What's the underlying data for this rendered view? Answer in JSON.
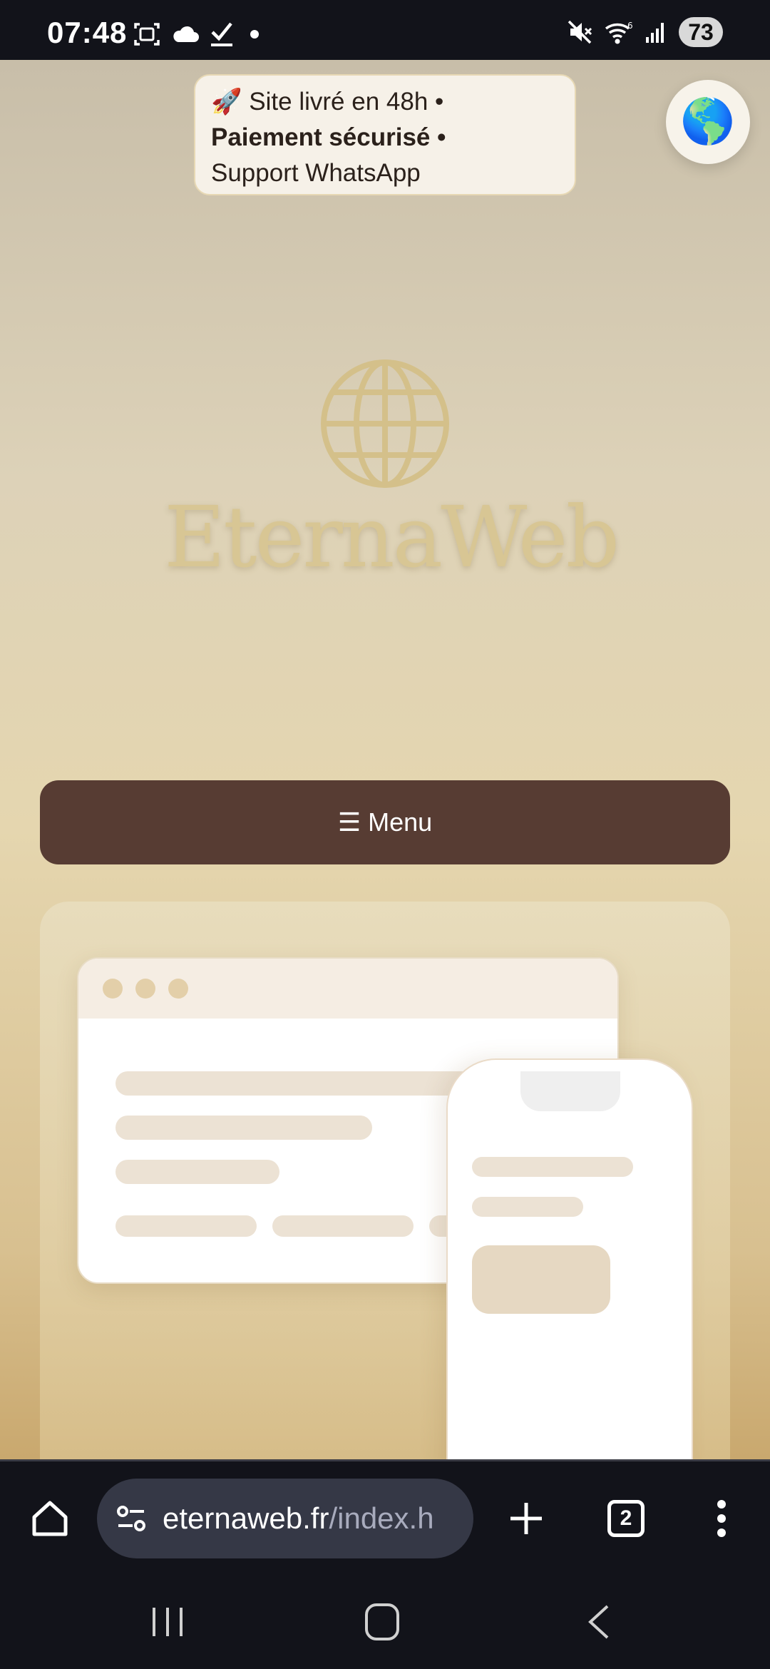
{
  "status_bar": {
    "time": "07:48",
    "battery": "73",
    "left_icons": [
      "screenshot-icon",
      "cloud-icon",
      "check-icon",
      "dot-icon"
    ],
    "right_icons": [
      "mute-icon",
      "wifi-icon",
      "signal-icon",
      "battery-icon"
    ]
  },
  "page": {
    "trust_banner": {
      "line1": "🚀 Site livré en 48h •",
      "line2": "Paiement sécurisé •",
      "line3": "Support WhatsApp"
    },
    "language_button_icon": "🌎",
    "logo_text": "EternaWeb",
    "menu_label": "☰ Menu"
  },
  "browser": {
    "url_domain": "eternaweb.fr",
    "url_path": "/index.h",
    "tab_count": "2"
  },
  "colors": {
    "menu_bg": "#573c33",
    "logo_gold": "#d8c694",
    "system_bg": "#12131a"
  }
}
